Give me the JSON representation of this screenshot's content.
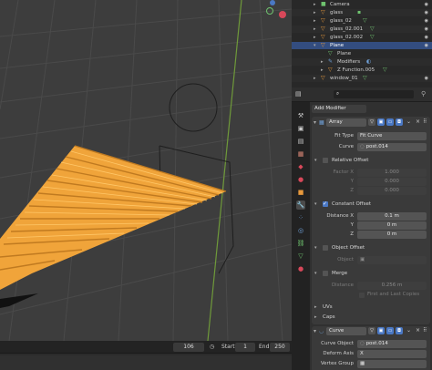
{
  "outliner": {
    "rows": [
      {
        "label": "Camera",
        "icon": "camera-icon"
      },
      {
        "label": "glass",
        "icon": "mesh-icon"
      },
      {
        "label": "glass_02",
        "icon": "mesh-icon"
      },
      {
        "label": "glass_02.001",
        "icon": "mesh-icon"
      },
      {
        "label": "glass_02.002",
        "icon": "mesh-icon"
      },
      {
        "label": "Plane",
        "icon": "mesh-icon",
        "selected": true
      },
      {
        "label": "Plane",
        "icon": "mesh-data-icon"
      },
      {
        "label": "Modifiers",
        "icon": "wrench-icon"
      },
      {
        "label": "Z Function.005",
        "icon": "mesh-icon"
      },
      {
        "label": "window_01",
        "icon": "mesh-icon"
      },
      {
        "label": "window_02",
        "icon": "mesh-icon"
      }
    ]
  },
  "properties": {
    "search_placeholder": "",
    "add_modifier_label": "Add Modifier",
    "array": {
      "name": "Array",
      "fit_type_label": "Fit Type",
      "fit_type_value": "Fit Curve",
      "curve_label": "Curve",
      "curve_value": "post.014",
      "relative_offset_label": "Relative Offset",
      "relative_offset_enabled": false,
      "factor_labels": [
        "Factor X",
        "Y",
        "Z"
      ],
      "factor_values": [
        "1.000",
        "0.000",
        "0.000"
      ],
      "constant_offset_label": "Constant Offset",
      "constant_offset_enabled": true,
      "distance_labels": [
        "Distance X",
        "Y",
        "Z"
      ],
      "distance_values": [
        "0.1 m",
        "0 m",
        "0 m"
      ],
      "object_offset_label": "Object Offset",
      "object_offset_enabled": false,
      "object_label": "Object",
      "merge_label": "Merge",
      "merge_enabled": false,
      "merge_distance_label": "Distance",
      "merge_distance_value": "0.256 m",
      "first_last_label": "First and Last Copies",
      "uvs_label": "UVs",
      "caps_label": "Caps"
    },
    "curve_mod": {
      "name": "Curve",
      "curve_object_label": "Curve Object",
      "curve_object_value": "post.014",
      "deform_axis_label": "Deform Axis",
      "deform_axis_value": "X",
      "vertex_group_label": "Vertex Group"
    }
  },
  "timeline": {
    "current_frame": "106",
    "start_label": "Start",
    "start_value": "1",
    "end_label": "End",
    "end_value": "250"
  },
  "colors": {
    "viewport_bg": "#3d3d3d",
    "object_orange": "#f0a43a",
    "selection_blue": "#334d80",
    "accent_blue": "#4a78c4"
  }
}
